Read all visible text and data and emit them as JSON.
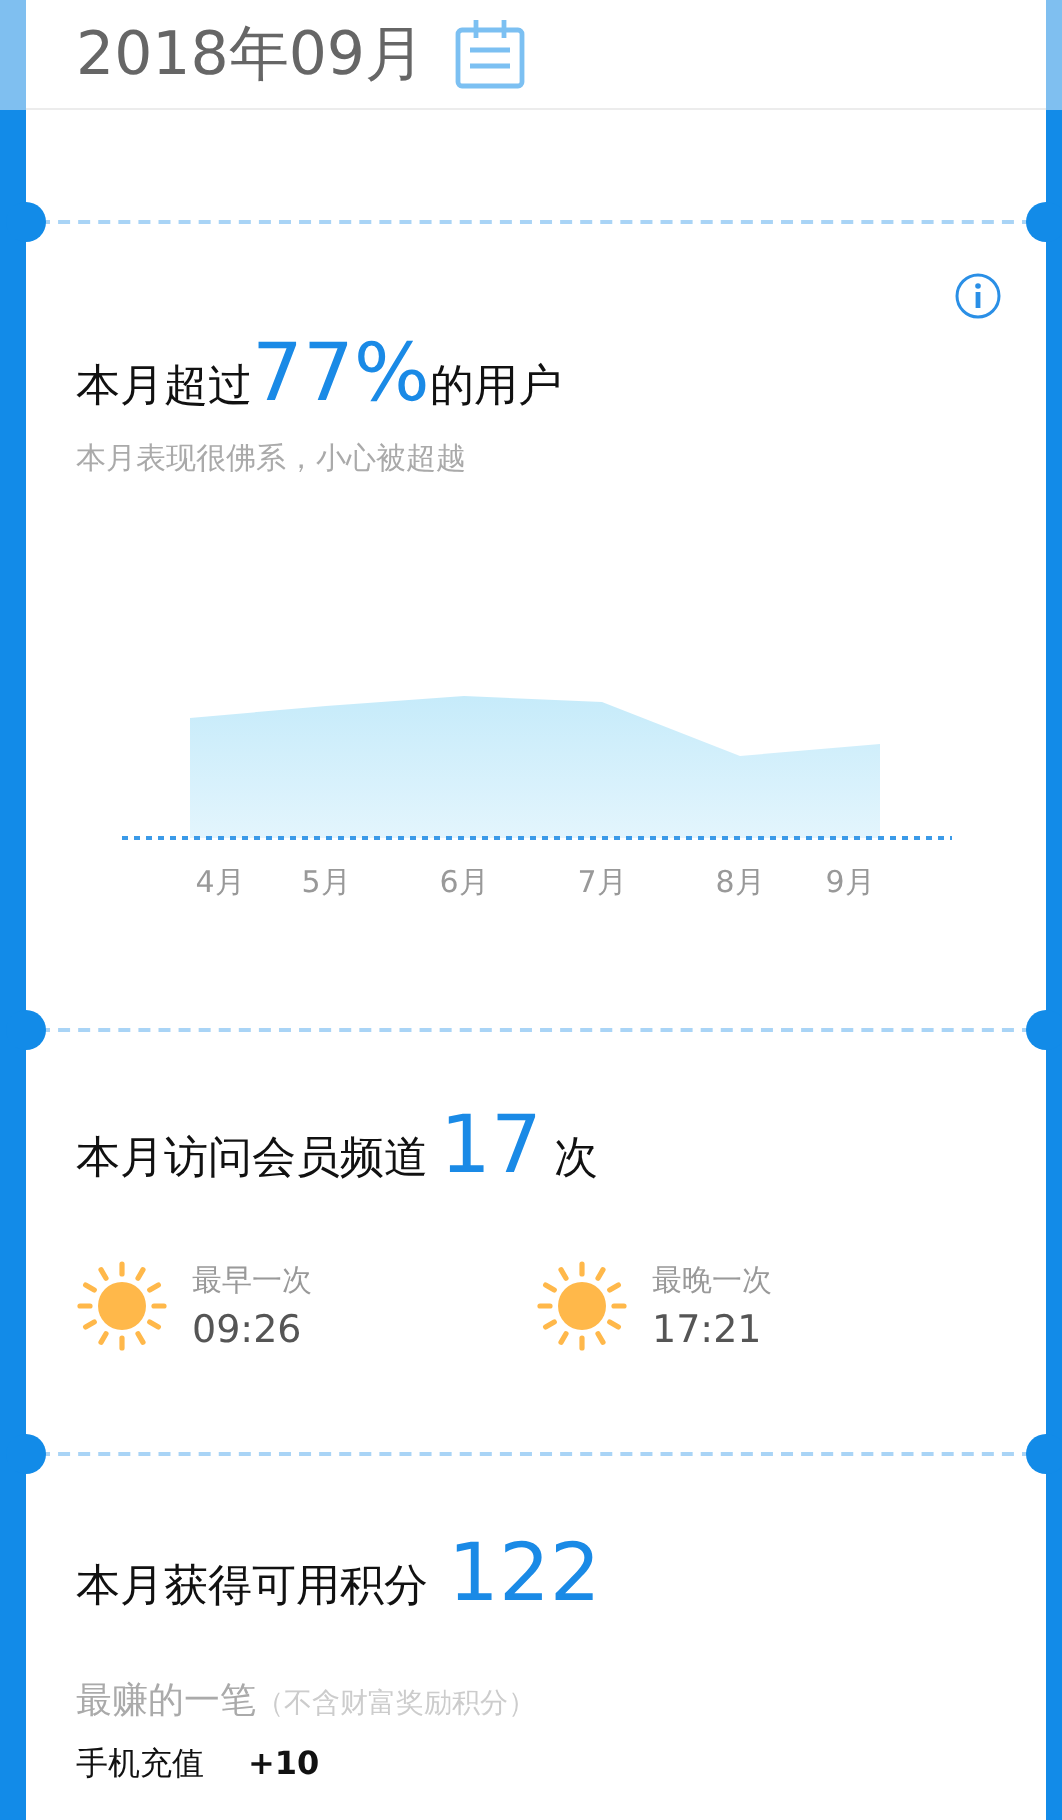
{
  "header": {
    "month": "2018年09月"
  },
  "rank": {
    "prefix": "本月超过",
    "value": "77%",
    "suffix": "的用户",
    "subtitle": "本月表现很佛系，小心被超越",
    "months": [
      "4月",
      "5月",
      "6月",
      "7月",
      "8月",
      "9月"
    ]
  },
  "visits": {
    "prefix": "本月访问会员频道",
    "count": "17",
    "suffix": "次",
    "times": [
      {
        "label": "最早一次",
        "value": "09:26"
      },
      {
        "label": "最晚一次",
        "value": "17:21"
      }
    ]
  },
  "points": {
    "prefix": "本月获得可用积分",
    "value": "122",
    "best_label": "最赚的一笔",
    "best_note": "（不含财富奖励积分）",
    "best_item": "手机充值",
    "best_points": "+10"
  }
}
